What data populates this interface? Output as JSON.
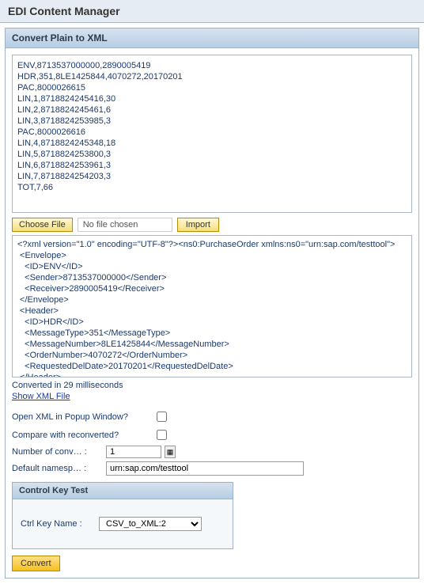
{
  "pageTitle": "EDI Content Manager",
  "convertPanel": {
    "title": "Convert Plain to XML",
    "plainText": "ENV,8713537000000,2890005419\nHDR,351,8LE1425844,4070272,20170201\nPAC,8000026615\nLIN,1,8718824245416,30\nLIN,2,8718824245461,6\nLIN,3,8718824253985,3\nPAC,8000026616\nLIN,4,8718824245348,18\nLIN,5,8718824253800,3\nLIN,6,8718824253961,3\nLIN,7,8718824254203,3\nTOT,7,66",
    "chooseFileLabel": "Choose File",
    "fileChosenText": "No file chosen",
    "importLabel": "Import",
    "xmlOutput": "<?xml version=\"1.0\" encoding=\"UTF-8\"?><ns0:PurchaseOrder xmlns:ns0=\"urn:sap.com/testtool\">\n <Envelope>\n   <ID>ENV</ID>\n   <Sender>8713537000000</Sender>\n   <Receiver>2890005419</Receiver>\n </Envelope>\n <Header>\n   <ID>HDR</ID>\n   <MessageType>351</MessageType>\n   <MessageNumber>8LE1425844</MessageNumber>\n   <OrderNumber>4070272</OrderNumber>\n   <RequestedDelDate>20170201</RequestedDelDate>\n </Header>\n <Carton>\n   <ID>PAC</ID>",
    "statusText": "Converted in 29 milliseconds",
    "showXmlLink": "Show XML File",
    "openPopupLabel": "Open XML in Popup Window?",
    "compareLabel": "Compare with reconverted?",
    "numConvLabel": "Number of conv… :",
    "numConvValue": "1",
    "defaultNsLabel": "Default namesp… :",
    "defaultNsValue": "urn:sap.com/testtool",
    "controlKeyPanel": {
      "title": "Control Key Test",
      "ctrlKeyLabel": "Ctrl Key Name :",
      "ctrlKeyValue": "CSV_to_XML:2"
    },
    "convertButton": "Convert"
  }
}
